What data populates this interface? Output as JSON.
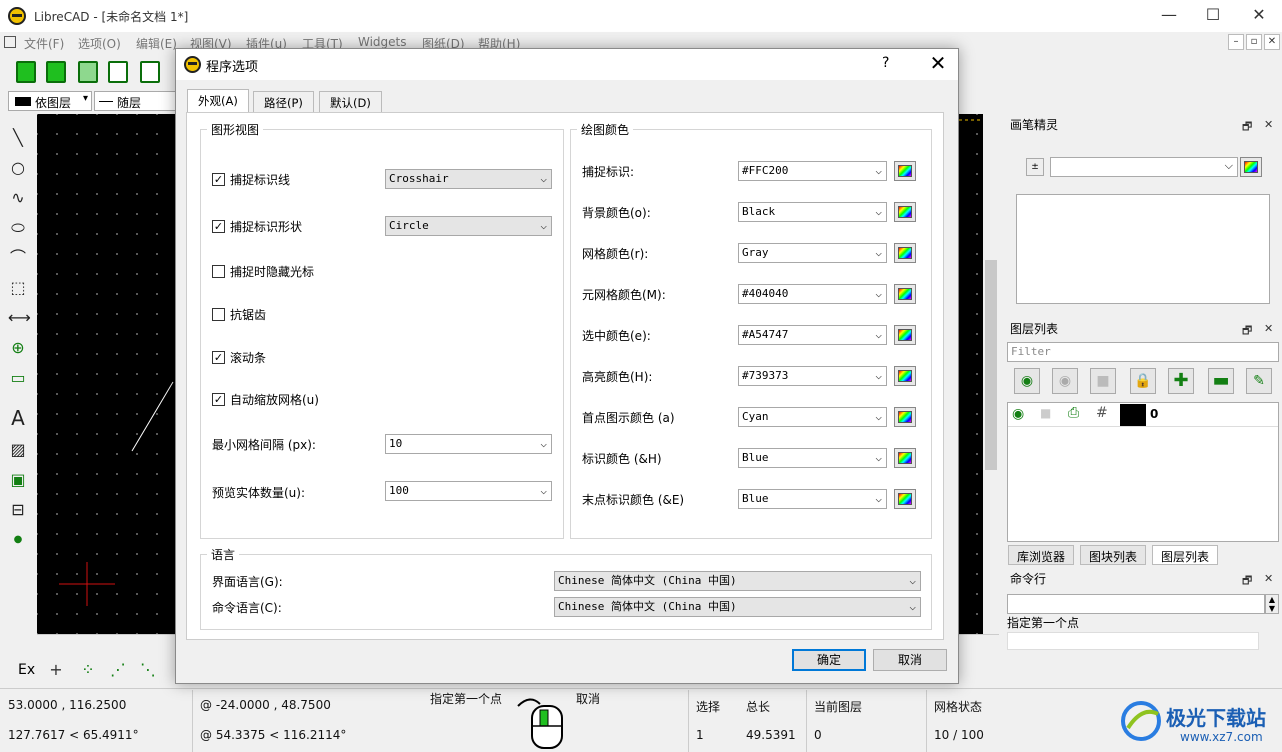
{
  "window": {
    "title": "LibreCAD - [未命名文档 1*]",
    "min": "—",
    "max": "☐",
    "close": "✕"
  },
  "menu": [
    "文件(F)",
    "选项(O)",
    "编辑(E)",
    "视图(V)",
    "插件(u)",
    "工具(T)",
    "Widgets",
    "图纸(D)",
    "帮助(H)"
  ],
  "propbar": {
    "layer": "依图层",
    "linetype": "随层"
  },
  "snap": {
    "ex": "Ex"
  },
  "status": {
    "abs_coord": "53.0000 , 116.2500",
    "abs_polar": "127.7617 < 65.4911°",
    "rel_coord": "@  -24.0000 , 48.7500",
    "rel_polar": "@  54.3375 < 116.2114°",
    "prompt_left": "指定第一个点",
    "prompt_right": "取消",
    "select_label": "选择",
    "select_value": "1",
    "total_label": "总长",
    "total_value": "49.5391",
    "layer_label": "当前图层",
    "layer_value": "0",
    "grid_label": "网格状态",
    "grid_value": "10 / 100"
  },
  "right": {
    "pen_title": "画笔精灵",
    "layers_title": "图层列表",
    "filter_placeholder": "Filter",
    "layer_name": "0",
    "tabs": [
      "库浏览器",
      "图块列表",
      "图层列表"
    ],
    "cmd_title": "命令行",
    "cmd_text": "指定第一个点",
    "dock_float": "🗗",
    "dock_close": "✕"
  },
  "watermark": {
    "text": "极光下载站",
    "url": "www.xz7.com"
  },
  "dialog": {
    "title": "程序选项",
    "help": "?",
    "close": "✕",
    "tabs": [
      "外观(A)",
      "路径(P)",
      "默认(D)"
    ],
    "graphic": {
      "title": "图形视图",
      "crosshair_label": "捕捉标识线",
      "crosshair_value": "Crosshair",
      "shape_label": "捕捉标识形状",
      "shape_value": "Circle",
      "hide_cursor_label": "捕捉时隐藏光标",
      "antialias_label": "抗锯齿",
      "scrollbars_label": "滚动条",
      "autoscale_label": "自动缩放网格(u)",
      "min_grid_label": "最小网格间隔 (px):",
      "min_grid_value": "10",
      "preview_label": "预览实体数量(u):",
      "preview_value": "100"
    },
    "colors": {
      "title": "绘图颜色",
      "rows": [
        {
          "label": "捕捉标识:",
          "value": "#FFC200"
        },
        {
          "label": "背景颜色(o):",
          "value": "Black"
        },
        {
          "label": "网格颜色(r):",
          "value": "Gray"
        },
        {
          "label": "元网格颜色(M):",
          "value": "#404040"
        },
        {
          "label": "选中颜色(e):",
          "value": "#A54747"
        },
        {
          "label": "高亮颜色(H):",
          "value": "#739373"
        },
        {
          "label": "首点图示颜色 (a)",
          "value": "Cyan"
        },
        {
          "label": "标识颜色 (&H)",
          "value": "Blue"
        },
        {
          "label": "末点标识颜色 (&E)",
          "value": "Blue"
        }
      ]
    },
    "language": {
      "title": "语言",
      "ui_label": "界面语言(G):",
      "ui_value": "Chinese 简体中文 (China 中国)",
      "cmd_label": "命令语言(C):",
      "cmd_value": "Chinese 简体中文 (China 中国)"
    },
    "ok": "确定",
    "cancel": "取消"
  },
  "colors": {
    "canvas_bg": "#000000",
    "crosshair": "#d01010",
    "accent": "#0078d7"
  }
}
